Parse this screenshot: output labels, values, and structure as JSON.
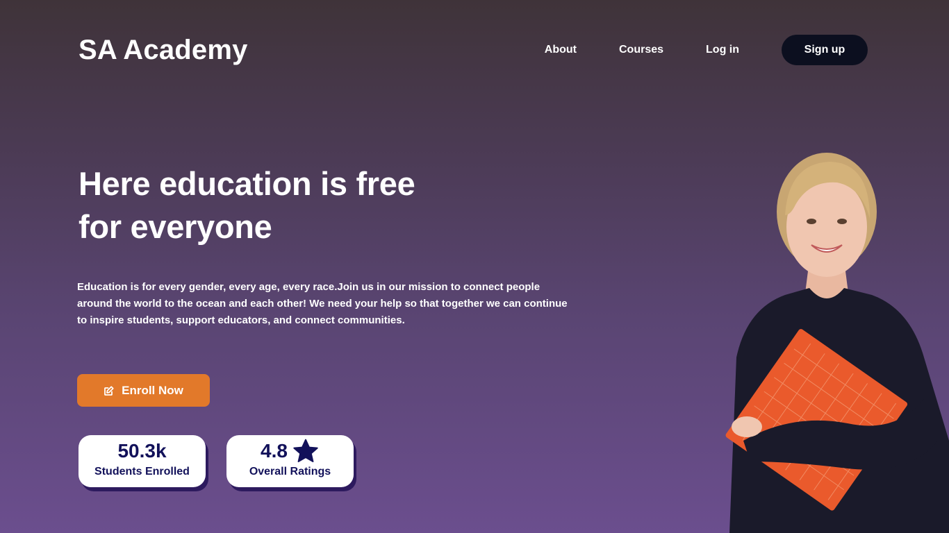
{
  "header": {
    "logo": "SA Academy",
    "nav": [
      "About",
      "Courses",
      "Log in"
    ],
    "signup_label": "Sign up"
  },
  "hero": {
    "title_line1": "Here education is free",
    "title_line2": "for everyone",
    "description": "Education is for every gender, every age, every race.Join us in our mission to connect people around the world to the ocean and each other! We need your help so that together we can continue to inspire students, support educators, and connect communities.",
    "enroll_label": "Enroll Now",
    "enroll_icon": "edit-icon"
  },
  "stats": {
    "students": {
      "value": "50.3k",
      "label": "Students Enrolled"
    },
    "ratings": {
      "value": "4.8",
      "label": "Overall Ratings",
      "icon": "star-icon"
    }
  },
  "colors": {
    "accent_orange": "#e2792a",
    "signup_bg": "#0c0f1f",
    "stat_text": "#12115a",
    "stat_shadow": "#2d1a5e"
  }
}
